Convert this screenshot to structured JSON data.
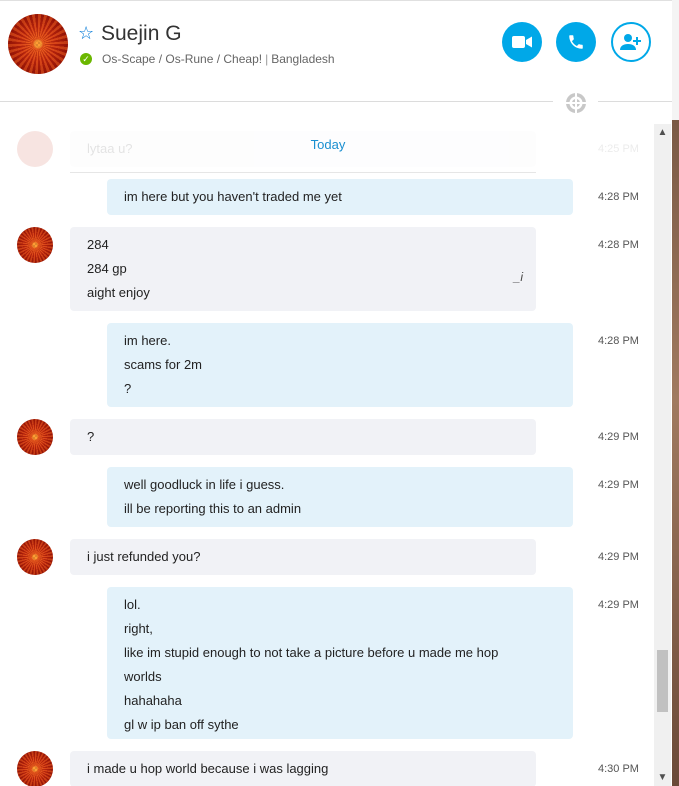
{
  "contact": {
    "name": "Suejin G",
    "mood_parts": [
      "Os-Scape / Os-Rune / Cheap!",
      "Bangladesh"
    ],
    "status": "online"
  },
  "header_buttons": {
    "video": "video-call",
    "call": "audio-call",
    "add": "add-people"
  },
  "chat": {
    "faded_preview": {
      "text": "lytaa u?",
      "time": "4:25 PM"
    },
    "day_label": "Today",
    "messages": [
      {
        "direction": "out",
        "lines": [
          "im here but you haven't traded me yet"
        ],
        "time": "4:28 PM"
      },
      {
        "direction": "in",
        "lines": [
          "284",
          "284 gp",
          "aight enjoy"
        ],
        "time": "4:28 PM",
        "edited": true
      },
      {
        "direction": "out",
        "lines": [
          "im here.",
          "scams for 2m",
          "?"
        ],
        "time": "4:28 PM"
      },
      {
        "direction": "in",
        "lines": [
          "?"
        ],
        "time": "4:29 PM"
      },
      {
        "direction": "out",
        "lines": [
          "well goodluck in life i guess.",
          "ill be reporting this to an admin"
        ],
        "time": "4:29 PM"
      },
      {
        "direction": "in",
        "lines": [
          "i just refunded you?"
        ],
        "time": "4:29 PM"
      },
      {
        "direction": "out",
        "lines": [
          "lol.",
          "right,",
          "like im stupid enough to not take a picture before u made me hop worlds",
          "hahahaha",
          "gl w ip ban off sythe"
        ],
        "time": "4:29 PM"
      },
      {
        "direction": "in",
        "lines": [
          "i made u hop world because i was lagging"
        ],
        "time": "4:30 PM"
      }
    ]
  },
  "colors": {
    "accent": "#00a8e8",
    "incoming_bubble": "#f1f2f6",
    "outgoing_bubble": "#e3f2fa",
    "online": "#6bb700"
  }
}
